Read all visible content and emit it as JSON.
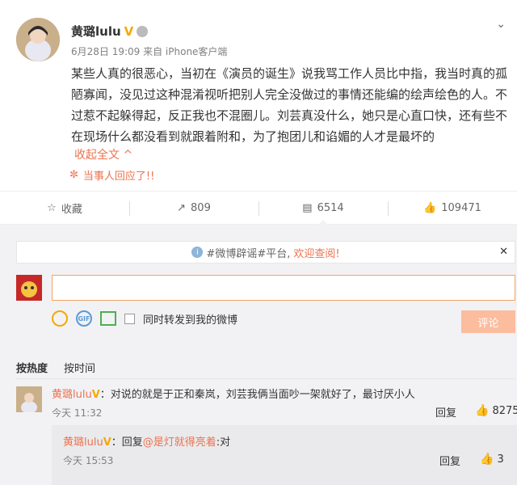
{
  "post": {
    "author": "黄璐lulu",
    "meta": "6月28日 19:09 来自 iPhone客户端",
    "text": "某些人真的很恶心，当初在《演员的诞生》说我骂工作人员比中指，我当时真的孤陋寡闻，没见过这种混淆视听把别人完全没做过的事情还能编的绘声绘色的人。不过惹不起躲得起，反正我也不混圈儿。刘芸真没什么，她只是心直口快，还有些不在现场什么都没看到就跟着附和，为了抱团儿和谄媚的人才是最坏的",
    "collapse_label": "收起全文",
    "notice": "当事人回应了!!"
  },
  "actions": {
    "favorite": "收藏",
    "repost": "809",
    "comment": "6514",
    "like": "109471"
  },
  "comment_panel": {
    "info_prefix": "#微博辟谣#平台,",
    "info_highlight": "欢迎查阅!",
    "repost_check_label": "同时转发到我的微博",
    "submit_label": "评论",
    "sort_hot": "按热度",
    "sort_time": "按时间"
  },
  "comments": [
    {
      "author": "黄璐lulu",
      "text": "：对说的就是于正和秦岚，刘芸我俩当面吵一架就好了，最讨厌小人",
      "time": "今天 11:32",
      "reply_label": "回复",
      "likes": "8275"
    }
  ],
  "replies": [
    {
      "author": "黄璐lulu",
      "text_prefix": "：回复",
      "mention": "@是灯就得亮着",
      "text_suffix": ":对",
      "time": "今天 15:53",
      "reply_label": "回复",
      "likes": "3"
    }
  ],
  "colors": {
    "accent": "#eb7350",
    "verified": "#f6a800",
    "panel_bg": "#f2f2f5"
  }
}
